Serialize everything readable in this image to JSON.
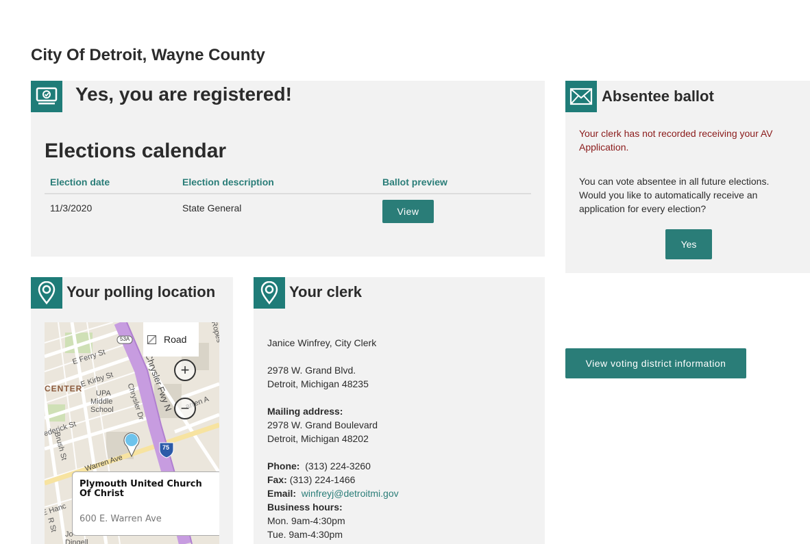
{
  "page": {
    "title": "City Of Detroit, Wayne County"
  },
  "colors": {
    "accent": "#2a7d78",
    "warning": "#8a1a1a",
    "panel": "#f2f2f2"
  },
  "registration": {
    "icon": "voting-machine-icon",
    "heading": "Yes, you are registered!",
    "calendar_title": "Elections calendar",
    "columns": [
      "Election date",
      "Election description",
      "Ballot preview"
    ],
    "rows": [
      {
        "date": "11/3/2020",
        "description": "State General",
        "action": "View"
      }
    ]
  },
  "absentee": {
    "icon": "envelope-icon",
    "heading": "Absentee ballot",
    "warning": "Your clerk has not recorded receiving your AV Application.",
    "text": "You can vote absentee in all future elections. Would you like to automatically receive an application for every election?",
    "yes_label": "Yes"
  },
  "district": {
    "button_label": "View voting district information"
  },
  "polling": {
    "icon": "location-pin-icon",
    "heading": "Your polling location",
    "map": {
      "mode_label": "Road",
      "zoom_in": "+",
      "zoom_out": "−",
      "labels": {
        "ferry": "E Ferry St",
        "kirby": "E Kirby St",
        "center": "CENTER",
        "upa1": "UPA",
        "upa2": "Middle",
        "upa3": "School",
        "chrysler1": "Chrysler Fwy N",
        "chrysler2": "Chrysler Dr",
        "frederick": "ederick St",
        "brush": "Brush St",
        "warren": "Warren Ave",
        "hwy53": "53A",
        "i75": "75",
        "ropes": "Ropes",
        "warren2": "arren A",
        "cyler": "ysler Dr",
        "hancock": "E Hanc",
        "dingell": "Dingell",
        "jo": "Jo",
        "rost": "R St"
      },
      "place_name": "Plymouth United Church Of Christ",
      "place_address": "600 E. Warren Ave"
    }
  },
  "clerk": {
    "icon": "location-pin-icon",
    "heading": "Your clerk",
    "name": "Janice Winfrey, City Clerk",
    "address1": "2978 W. Grand Blvd.",
    "address2": "Detroit, Michigan 48235",
    "mailing_label": "Mailing address:",
    "mailing1": "2978 W. Grand Boulevard",
    "mailing2": "Detroit, Michigan 48202",
    "phone_label": "Phone:",
    "phone": "(313) 224-3260",
    "fax_label": "Fax:",
    "fax": "(313) 224-1466",
    "email_label": "Email:",
    "email": "winfreyj@detroitmi.gov",
    "hours_label": "Business hours:",
    "hours": [
      "Mon. 9am-4:30pm",
      "Tue. 9am-4:30pm"
    ]
  }
}
